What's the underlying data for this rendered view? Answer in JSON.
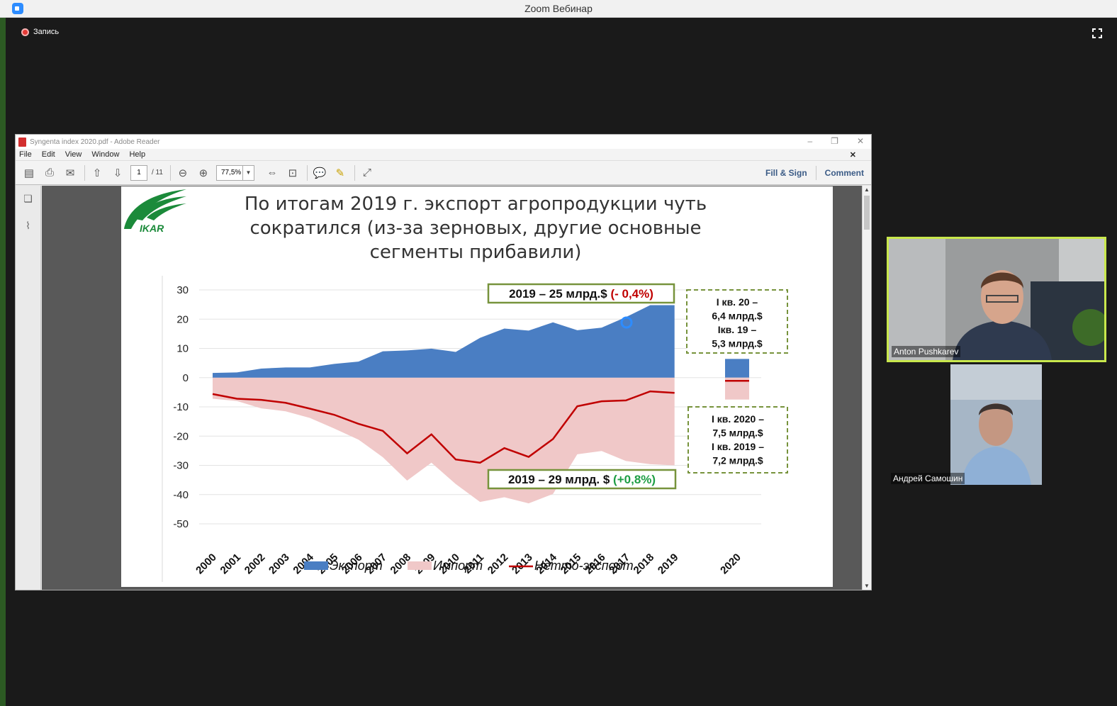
{
  "app": {
    "window_title": "Zoom Вебинар",
    "recording_label": "Запись"
  },
  "reader": {
    "title": "Syngenta index 2020.pdf - Adobe Reader",
    "menu": [
      "File",
      "Edit",
      "View",
      "Window",
      "Help"
    ],
    "page_current": "1",
    "page_total": "/ 11",
    "zoom": "77,5%",
    "fill_sign": "Fill & Sign",
    "comment": "Comment"
  },
  "slide": {
    "title_lines": [
      "По итогам 2019 г. экспорт агропродукции чуть",
      "сократился (из-за зерновых, другие основные",
      "сегменты прибавили)"
    ],
    "logo_text": "IKAR",
    "export_note_prefix": "2019 – 25 млрд.$",
    "export_note_change": "(- 0,4%)",
    "import_note_prefix": "2019 – 29 млрд. $",
    "import_note_change": "(+0,8%)",
    "q1_export_lines": [
      "I кв. 20 –",
      "6,4 млрд.$",
      "Iкв. 19 –",
      "5,3 млрд.$"
    ],
    "q1_import_lines": [
      "I кв. 2020 –",
      "7,5 млрд.$",
      "I кв. 2019 –",
      "7,2 млрд.$"
    ]
  },
  "chart_data": {
    "type": "area",
    "x": [
      "2000",
      "2001",
      "2002",
      "2003",
      "2004",
      "2005",
      "2006",
      "2007",
      "2008",
      "2009",
      "2010",
      "2011",
      "2012",
      "2013",
      "2014",
      "2015",
      "2016",
      "2017",
      "2018",
      "2019"
    ],
    "extra_category": "2020",
    "ylim": [
      -50,
      30
    ],
    "yticks": [
      "30",
      "20",
      "10",
      "0",
      "-10",
      "-20",
      "-30",
      "-40",
      "-50"
    ],
    "series": [
      {
        "name": "Экспорт",
        "color": "#4a7ec3",
        "values": [
          1.6,
          1.8,
          3.1,
          3.5,
          3.5,
          4.7,
          5.5,
          9.0,
          9.3,
          9.9,
          8.8,
          13.6,
          16.8,
          16.1,
          18.9,
          16.2,
          17.1,
          20.7,
          24.8,
          24.8
        ]
      },
      {
        "name": "Импорт",
        "color": "#f0c8c8",
        "values": [
          -7.2,
          -8.0,
          -10.5,
          -11.5,
          -13.8,
          -17.4,
          -21.2,
          -27.2,
          -35.2,
          -29.1,
          -36.4,
          -42.5,
          -40.9,
          -43.0,
          -39.8,
          -26.2,
          -25.1,
          -28.5,
          -29.6,
          -30.0
        ]
      },
      {
        "name": "Нетто-экспорт",
        "color": "#c00000",
        "values": [
          -5.6,
          -7.2,
          -7.6,
          -8.6,
          -10.6,
          -12.7,
          -15.8,
          -18.2,
          -25.9,
          -19.4,
          -28.0,
          -29.1,
          -24.1,
          -27.1,
          -21.0,
          -9.8,
          -8.1,
          -7.8,
          -4.7,
          -5.2
        ]
      }
    ],
    "q1_2020": {
      "export": 6.4,
      "import": -7.5,
      "net": -1.1
    },
    "legend_position": "bottom"
  },
  "participants": [
    {
      "name": "Anton Pushkarev"
    },
    {
      "name": "Андрей Самошин"
    }
  ],
  "colors": {
    "export": "#4a7ec3",
    "import": "#f0c8c8",
    "net": "#c00000",
    "note_border": "#77933c",
    "active_speaker": "#c9e84c"
  }
}
